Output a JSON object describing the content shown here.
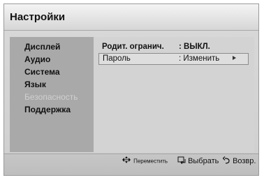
{
  "header": {
    "title": "Настройки"
  },
  "sidebar": {
    "items": [
      {
        "label": "Дисплей"
      },
      {
        "label": "Аудио"
      },
      {
        "label": "Система"
      },
      {
        "label": "Язык"
      },
      {
        "label": "Безопасность"
      },
      {
        "label": "Поддержка"
      }
    ]
  },
  "main": {
    "rows": [
      {
        "label": "Родит. огранич.",
        "value": ": ВЫКЛ."
      },
      {
        "label": "Пароль",
        "value": ": Изменить"
      }
    ]
  },
  "footer": {
    "move_label": "Переместить",
    "select_label": "Выбрать",
    "back_label": "Возвр."
  },
  "icons": {
    "move": "arrows-icon",
    "select": "enter-icon",
    "back": "return-icon",
    "row_arrow": "chevron-right-icon"
  }
}
